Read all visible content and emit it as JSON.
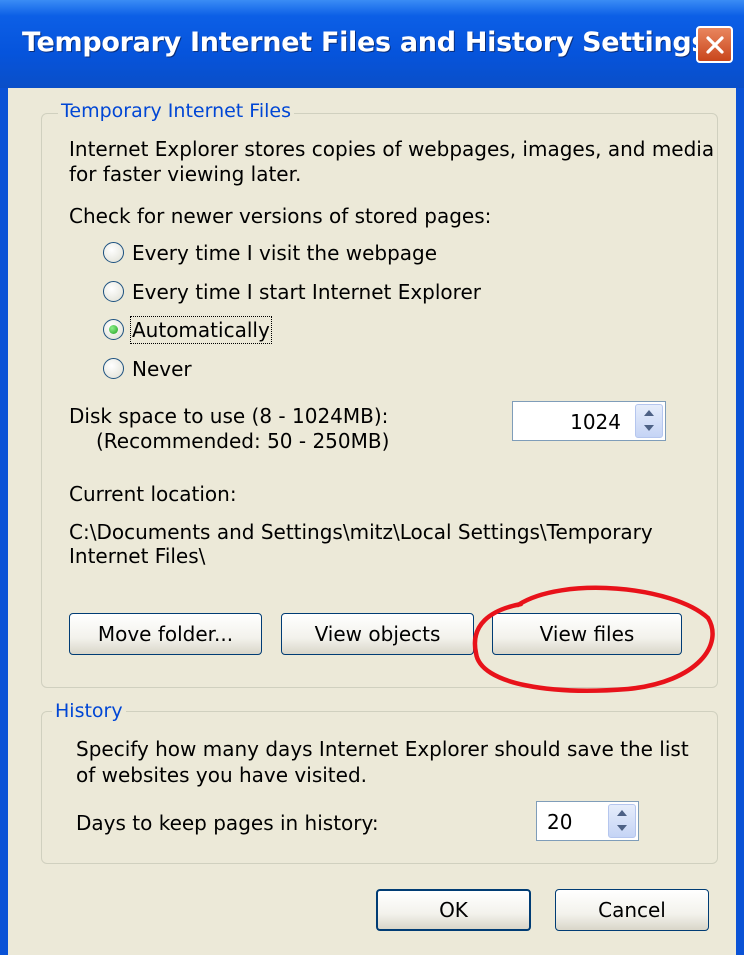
{
  "window": {
    "title": "Temporary Internet Files and History Settings"
  },
  "temp_files": {
    "group_label": "Temporary Internet Files",
    "description_line1": "Internet Explorer stores copies of webpages, images, and media",
    "description_line2": "for faster viewing later.",
    "check_label": "Check for newer versions of stored pages:",
    "options": [
      {
        "label": "Every time I visit the webpage",
        "selected": false
      },
      {
        "label": "Every time I start Internet Explorer",
        "selected": false
      },
      {
        "label": "Automatically",
        "selected": true
      },
      {
        "label": "Never",
        "selected": false
      }
    ],
    "disk_space_label": "Disk space to use (8 - 1024MB):",
    "disk_space_recommended": "(Recommended: 50 - 250MB)",
    "disk_space_value": "1024",
    "current_location_label": "Current location:",
    "location_line1": "C:\\Documents and Settings\\mitz\\Local Settings\\Temporary",
    "location_line2": "Internet Files\\",
    "buttons": {
      "move_folder": "Move folder...",
      "view_objects": "View objects",
      "view_files": "View files"
    }
  },
  "history": {
    "group_label": "History",
    "description_line1": "Specify how many days Internet Explorer should save the list",
    "description_line2": "of websites you have visited.",
    "days_label": "Days to keep pages in history:",
    "days_value": "20"
  },
  "footer": {
    "ok": "OK",
    "cancel": "Cancel"
  },
  "colors": {
    "titlebar": "#0654dc",
    "dialog": "#ece9d8",
    "group_label": "#0046d5",
    "annotation": "#e8121a"
  },
  "icons": {
    "close": "close-icon"
  }
}
